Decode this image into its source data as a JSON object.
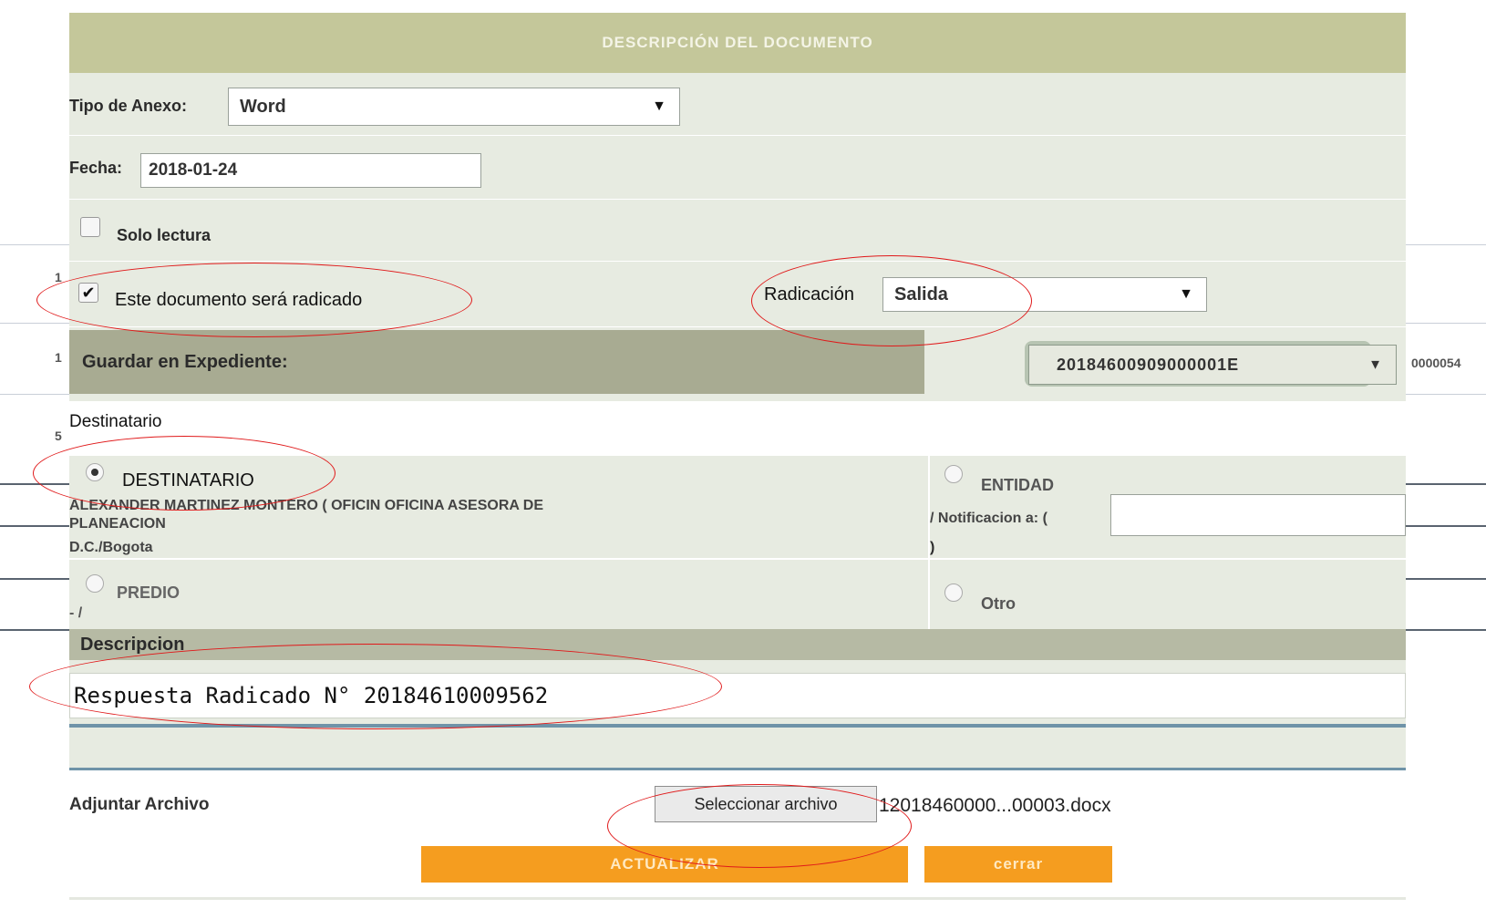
{
  "dialog": {
    "title": "DESCRIPCIÓN DEL DOCUMENTO"
  },
  "tipo_anexo": {
    "label": "Tipo de Anexo:",
    "value": "Word"
  },
  "fecha": {
    "label": "Fecha:",
    "value": "2018-01-24"
  },
  "solo_lectura": {
    "label": "Solo lectura",
    "checked": false
  },
  "radicado": {
    "label": "Este documento será radicado",
    "checked": true
  },
  "radicacion": {
    "label": "Radicación",
    "value": "Salida"
  },
  "expediente": {
    "label": "Guardar en Expediente:",
    "value": "20184600909000001E"
  },
  "destinatario": {
    "section_title": "Destinatario",
    "option_destinatario": {
      "label": "DESTINATARIO",
      "selected": true,
      "line1": "ALEXANDER MARTINEZ MONTERO ( OFICIN OFICINA ASESORA DE",
      "line2": "PLANEACION",
      "line3": "D.C./Bogota"
    },
    "option_entidad": {
      "label": "ENTIDAD",
      "selected": false,
      "notif_label": "/ Notificacion a: (",
      "notif_close": ")"
    },
    "option_predio": {
      "label": "PREDIO",
      "selected": false,
      "sub": "- /"
    },
    "option_otro": {
      "label": "Otro",
      "selected": false
    }
  },
  "descripcion": {
    "label": "Descripcion",
    "value": "Respuesta Radicado N° 20184610009562"
  },
  "adjuntar": {
    "label": "Adjuntar Archivo",
    "button_label": "Seleccionar archivo",
    "file_name": "12018460000...00003.docx"
  },
  "actions": {
    "update_label": "ACTUALIZAR",
    "close_label": "cerrar"
  },
  "background_fragments": {
    "frag_1": "1",
    "frag_2": "1",
    "frag_3": "5",
    "frag_right": "0000054"
  },
  "colors": {
    "header_bg": "#c4c79a",
    "panel_bg": "#e7ebe1",
    "button_orange": "#f59d1f",
    "annotation_red": "#e0191a"
  },
  "icons": {
    "select_arrow": "triangle-down-icon",
    "checkmark": "checkmark-icon"
  }
}
